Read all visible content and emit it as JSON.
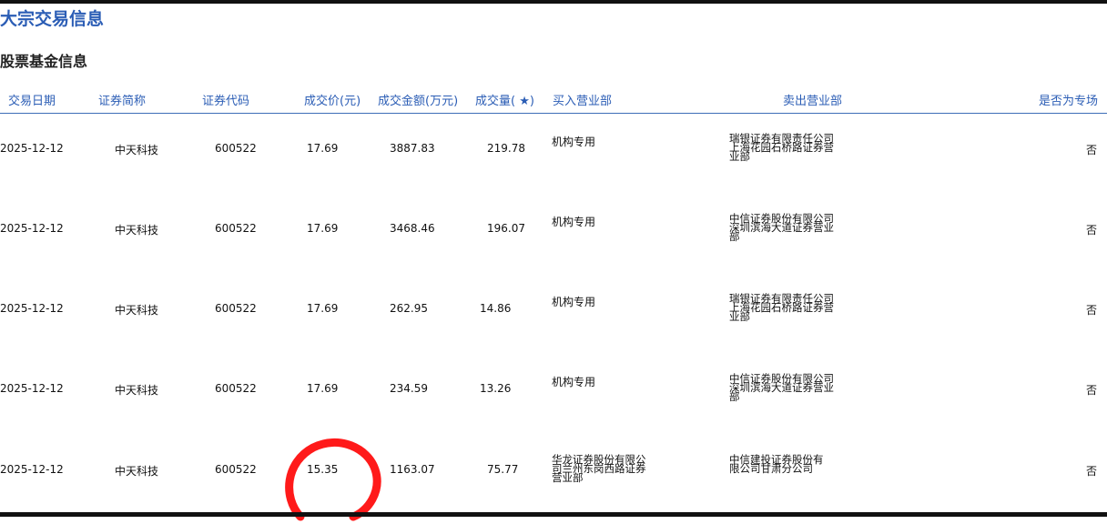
{
  "page": {
    "section_title": "大宗交易信息",
    "sub_title": "股票基金信息"
  },
  "table": {
    "headers": [
      "交易日期",
      "证券简称",
      "证券代码",
      "成交价(元)",
      "成交金额(万元)",
      "成交量( ★)",
      "买入营业部",
      "卖出营业部",
      "是否为专场"
    ],
    "rows": [
      [
        "2025-12-12",
        "中天科技",
        "600522",
        "17.69",
        "3887.83",
        "219.78",
        "机构专用",
        "瑞银证券有限责任公司上海花园石桥路证券营业部",
        "否"
      ],
      [
        "2025-12-12",
        "中天科技",
        "600522",
        "17.69",
        "3468.46",
        "196.07",
        "机构专用",
        "中信证券股份有限公司深圳滨海大道证券营业部",
        "否"
      ],
      [
        "2025-12-12",
        "中天科技",
        "600522",
        "17.69",
        "262.95",
        "14.86",
        "机构专用",
        "瑞银证券有限责任公司上海花园石桥路证券营业部",
        "否"
      ],
      [
        "2025-12-12",
        "中天科技",
        "600522",
        "17.69",
        "234.59",
        "13.26",
        "机构专用",
        "中信证券股份有限公司深圳滨海大道证券营业部",
        "否"
      ],
      [
        "2025-12-12",
        "中天科技",
        "600522",
        "15.35",
        "1163.07",
        "75.77",
        "华龙证券股份有限公司兰州东岗西路证券营业部",
        "中信建投证券股份有限公司甘肃分公司",
        "否"
      ]
    ]
  },
  "annotation": {
    "color": "#ff1a1a",
    "shape": "hand-drawn circle around price"
  }
}
